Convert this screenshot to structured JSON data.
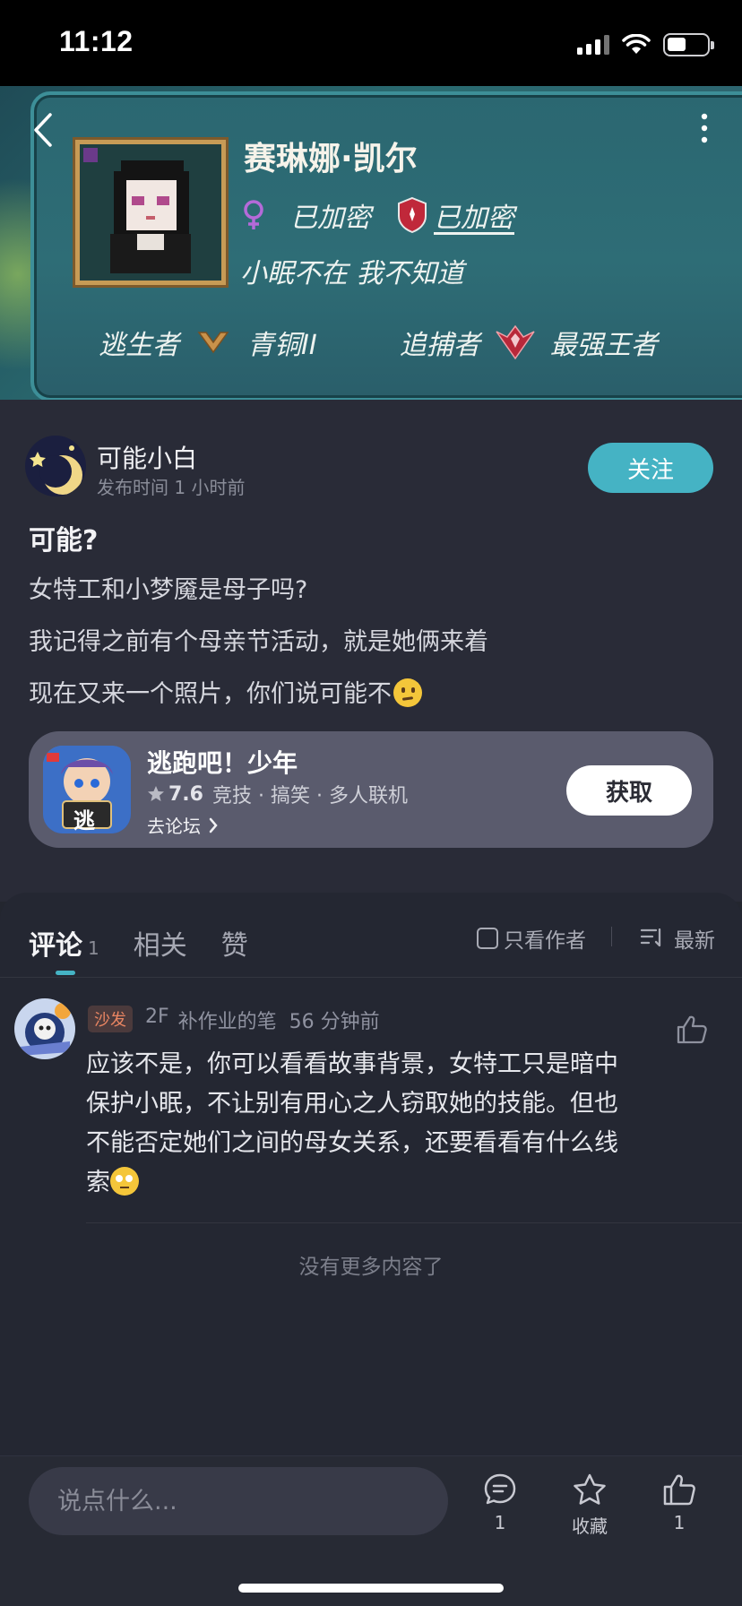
{
  "status_bar": {
    "time": "11:12"
  },
  "banner": {
    "gamer_name": "赛琳娜·凯尔",
    "gender_value": "已加密",
    "rank_value": "已加密",
    "bio": "小眠不在 我不知道",
    "survivor_label": "逃生者",
    "survivor_rank": "青铜II",
    "hunter_label": "追捕者",
    "hunter_rank": "最强王者"
  },
  "author": {
    "name": "可能小白",
    "time": "发布时间 1 小时前",
    "follow_label": "关注"
  },
  "post": {
    "title": "可能?",
    "lines": [
      "女特工和小梦魇是母子吗?",
      "我记得之前有个母亲节活动，就是她俩来着",
      "现在又来一个照片，你们说可能不"
    ]
  },
  "game_card": {
    "name": "逃跑吧！少年",
    "score": "7.6",
    "tags": "竞技 · 搞笑 · 多人联机",
    "forum_link": "去论坛",
    "get_label": "获取",
    "icon_text": "逃"
  },
  "comments_tabs": {
    "tabs": [
      {
        "label": "评论",
        "count": "1"
      },
      {
        "label": "相关"
      },
      {
        "label": "赞"
      }
    ],
    "only_author_label": "只看作者",
    "sort_label": "最新"
  },
  "comment": {
    "badge": "沙发",
    "floor": "2F",
    "user": "补作业的笔",
    "time": "56 分钟前",
    "text": "应该不是，你可以看看故事背景，女特工只是暗中\n保护小眠，不让别有用心之人窃取她的技能。但也\n不能否定她们之间的母女关系，还要看看有什么线\n索"
  },
  "no_more": "没有更多内容了",
  "bottom_bar": {
    "input_placeholder": "说点什么...",
    "comment_count": "1",
    "favorite_label": "收藏",
    "like_count": "1"
  },
  "colors": {
    "accent": "#45b3c4",
    "background": "#23262f",
    "badge": "#e98562"
  }
}
